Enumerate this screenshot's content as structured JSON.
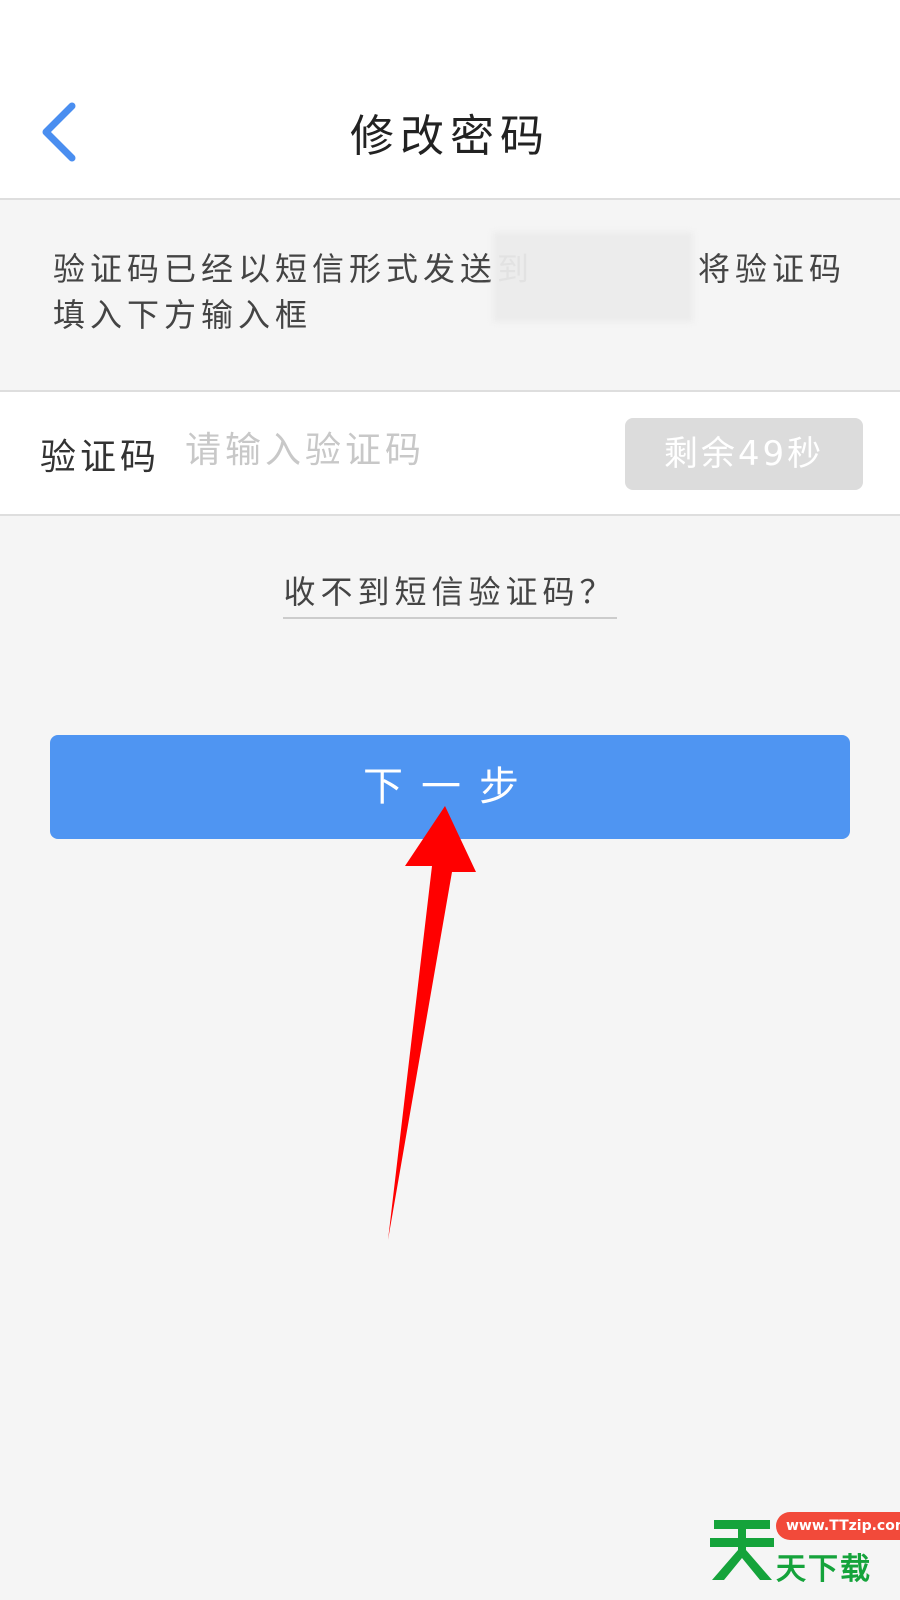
{
  "header": {
    "title": "修改密码",
    "back_icon": "chevron-left-icon"
  },
  "notice": {
    "text_prefix": "验证码已经以短信形式发送到",
    "text_suffix": "将验证码",
    "text_line2": "填入下方输入框"
  },
  "form": {
    "code_label": "验证码",
    "code_placeholder": "请输入验证码",
    "code_value": "",
    "countdown_label": "剩余49秒"
  },
  "help_link": "收不到短信验证码？",
  "next_button": "下一步",
  "watermark": {
    "url": "www.TTzip.com",
    "brand": "天下载"
  },
  "colors": {
    "accent_blue": "#4f95f2",
    "back_icon": "#4a8ef0",
    "disabled_button": "#dcdcdc",
    "annotation_arrow": "#ff0000",
    "watermark_green": "#15a33b",
    "watermark_badge": "#f24a3a"
  }
}
